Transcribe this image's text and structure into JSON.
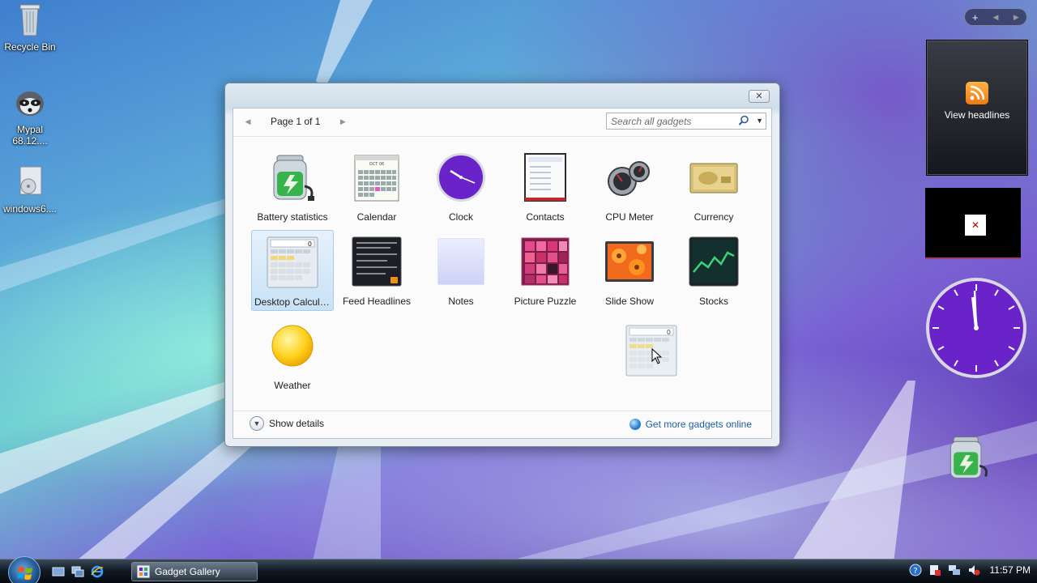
{
  "desktop": {
    "icons": [
      {
        "label": "Recycle Bin"
      },
      {
        "label": "Mypal 68.12...."
      },
      {
        "label": "windows6...."
      }
    ]
  },
  "gallery": {
    "pager_label": "Page 1 of 1",
    "search_placeholder": "Search all gadgets",
    "gadgets": [
      {
        "label": "Battery statistics",
        "icon": "battery-icon"
      },
      {
        "label": "Calendar",
        "icon": "calendar-icon"
      },
      {
        "label": "Clock",
        "icon": "clock-icon"
      },
      {
        "label": "Contacts",
        "icon": "contacts-icon"
      },
      {
        "label": "CPU Meter",
        "icon": "cpu-meter-icon"
      },
      {
        "label": "Currency",
        "icon": "currency-icon"
      },
      {
        "label": "Desktop Calcula...",
        "icon": "calculator-icon"
      },
      {
        "label": "Feed Headlines",
        "icon": "feed-icon"
      },
      {
        "label": "Notes",
        "icon": "notes-icon"
      },
      {
        "label": "Picture Puzzle",
        "icon": "puzzle-icon"
      },
      {
        "label": "Slide Show",
        "icon": "slideshow-icon"
      },
      {
        "label": "Stocks",
        "icon": "stocks-icon"
      },
      {
        "label": "Weather",
        "icon": "weather-icon"
      }
    ],
    "show_details_label": "Show details",
    "get_more_label": "Get more gadgets online"
  },
  "sidebar": {
    "add_label": "+",
    "feed_gadget_label": "View headlines"
  },
  "taskbar": {
    "task_label": "Gadget Gallery",
    "clock": "11:57 PM"
  },
  "colors": {
    "accent": "#1f5ea8",
    "clock_face": "#6a22c9",
    "selection": "#c9e1f6"
  }
}
